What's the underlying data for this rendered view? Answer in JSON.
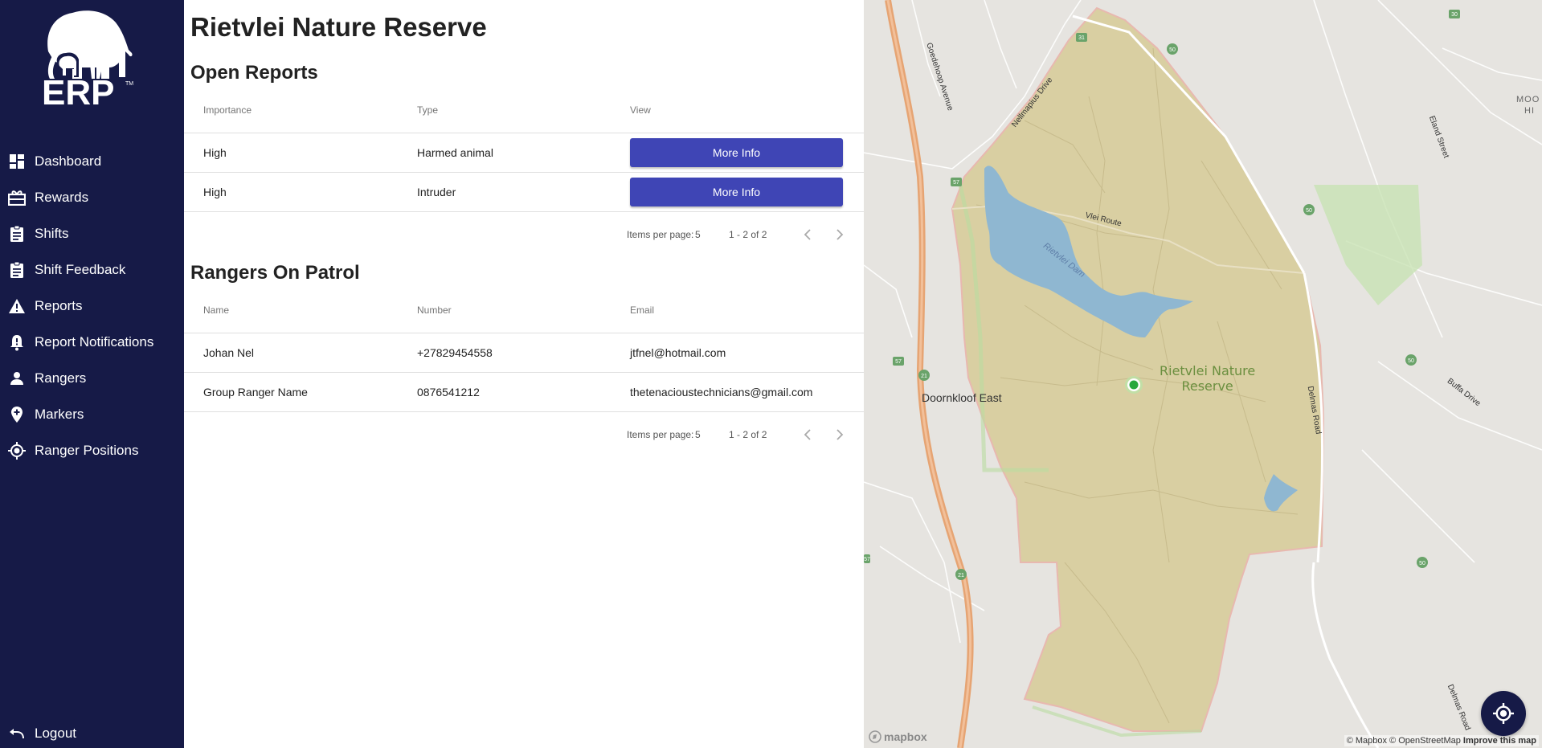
{
  "sidebar": {
    "logo_text": "ERP",
    "logo_tm": "TM",
    "items": [
      {
        "label": "Dashboard",
        "icon": "dashboard-icon"
      },
      {
        "label": "Rewards",
        "icon": "rewards-icon"
      },
      {
        "label": "Shifts",
        "icon": "clipboard-icon"
      },
      {
        "label": "Shift Feedback",
        "icon": "clipboard-icon"
      },
      {
        "label": "Reports",
        "icon": "warning-icon"
      },
      {
        "label": "Report Notifications",
        "icon": "bell-alert-icon"
      },
      {
        "label": "Rangers",
        "icon": "person-icon"
      },
      {
        "label": "Markers",
        "icon": "add-location-icon"
      },
      {
        "label": "Ranger Positions",
        "icon": "my-location-icon"
      }
    ],
    "logout_label": "Logout"
  },
  "main": {
    "title": "Rietvlei Nature Reserve",
    "open_reports": {
      "title": "Open Reports",
      "columns": [
        "Importance",
        "Type",
        "View"
      ],
      "rows": [
        {
          "importance": "High",
          "type": "Harmed animal",
          "action": "More Info"
        },
        {
          "importance": "High",
          "type": "Intruder",
          "action": "More Info"
        }
      ],
      "pager": {
        "items_per_page_label": "Items per page:",
        "items_per_page": "5",
        "range": "1 - 2 of 2"
      }
    },
    "rangers": {
      "title": "Rangers On Patrol",
      "columns": [
        "Name",
        "Number",
        "Email"
      ],
      "rows": [
        {
          "name": "Johan Nel",
          "number": "+27829454558",
          "email": "jtfnel@hotmail.com"
        },
        {
          "name": "Group Ranger Name",
          "number": "0876541212",
          "email": "thetenacioustechnicians@gmail.com"
        }
      ],
      "pager": {
        "items_per_page_label": "Items per page:",
        "items_per_page": "5",
        "range": "1 - 2 of 2"
      }
    }
  },
  "map": {
    "reserve_label_line1": "Rietvlei Nature",
    "reserve_label_line2": "Reserve",
    "dam_label": "Rietvlei Dam",
    "area_label": "Doornkloof East",
    "roads": [
      "Vlei Route",
      "Nellmapius Drive",
      "Goedehoop Avenue",
      "Eland Street",
      "Delmas Road",
      "Delmas Road",
      "Buffa Drive"
    ],
    "route_shields": [
      "31",
      "30",
      "50",
      "50",
      "50",
      "50",
      "57",
      "57",
      "21",
      "21",
      "57"
    ],
    "corner_label_1": "MOO",
    "corner_label_2": "HI",
    "mapbox_logo": "mapbox",
    "attribution": "© Mapbox © OpenStreetMap",
    "improve_link": "Improve this map",
    "geolocate_icon": "crosshair-icon",
    "colors": {
      "reserve_fill": "#d9cfa2",
      "water": "#8fb7d1",
      "highway": "#e6a473",
      "accent": "#3f45b5",
      "sidebar": "#161a47"
    }
  }
}
